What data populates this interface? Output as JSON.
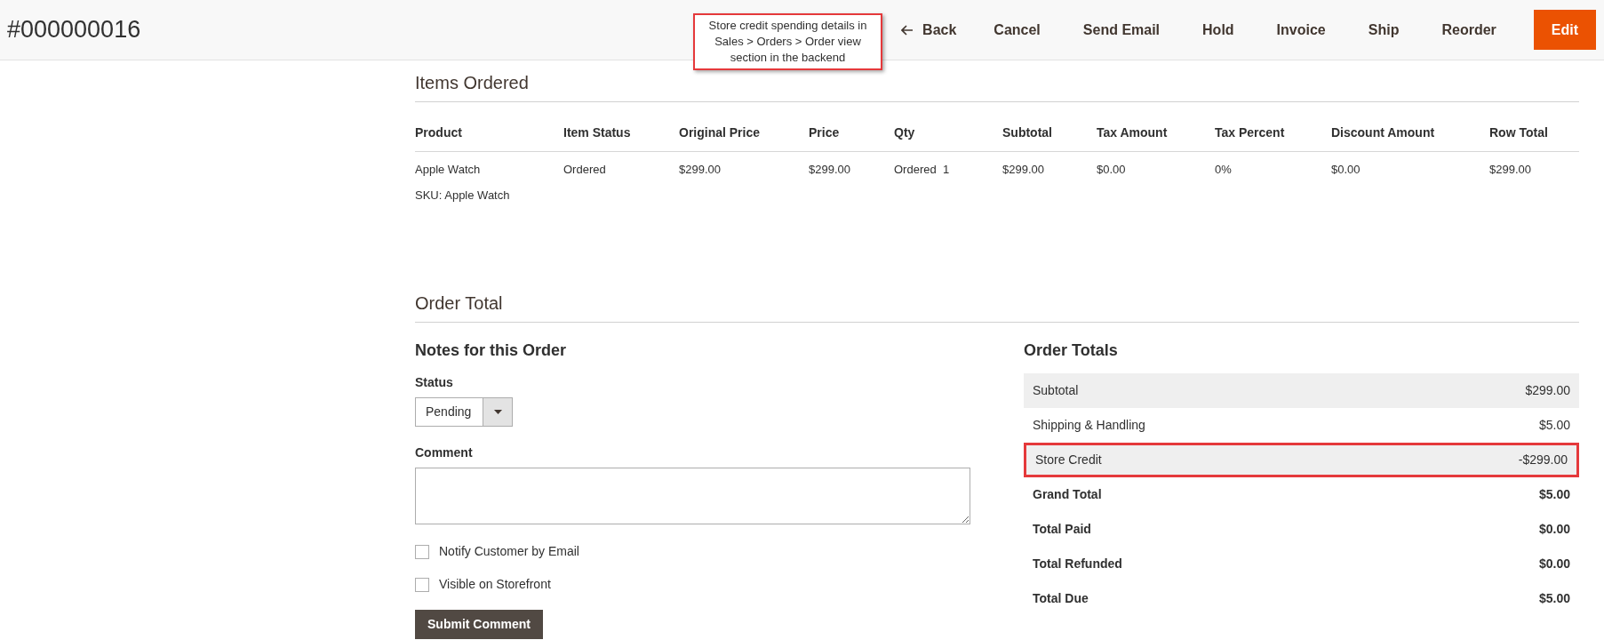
{
  "header": {
    "title": "#000000016",
    "back": "Back",
    "actions": [
      {
        "label": "Cancel",
        "kind": "plain"
      },
      {
        "label": "Send Email",
        "kind": "plain"
      },
      {
        "label": "Hold",
        "kind": "plain"
      },
      {
        "label": "Invoice",
        "kind": "plain"
      },
      {
        "label": "Ship",
        "kind": "plain"
      },
      {
        "label": "Reorder",
        "kind": "plain"
      },
      {
        "label": "Edit",
        "kind": "primary"
      }
    ]
  },
  "annotation": {
    "text": "Store credit spending details in Sales > Orders > Order view section in the backend"
  },
  "items_ordered": {
    "title": "Items Ordered",
    "columns": [
      "Product",
      "Item Status",
      "Original Price",
      "Price",
      "Qty",
      "Subtotal",
      "Tax Amount",
      "Tax Percent",
      "Discount Amount",
      "Row Total"
    ],
    "rows": [
      {
        "sku": "SKU: Apple Watch",
        "cells": [
          "Apple Watch",
          "Ordered",
          "$299.00",
          "$299.00",
          "Ordered  1",
          "$299.00",
          "$0.00",
          "0%",
          "$0.00",
          "$299.00"
        ]
      }
    ]
  },
  "order_total": {
    "title": "Order Total",
    "notes": {
      "title": "Notes for this Order",
      "status_label": "Status",
      "status_value": "Pending",
      "comment_label": "Comment",
      "checkboxes": [
        {
          "label": "Notify Customer by Email",
          "checked": false
        },
        {
          "label": "Visible on Storefront",
          "checked": false
        }
      ],
      "submit": "Submit Comment"
    },
    "totals": {
      "title": "Order Totals",
      "rows": [
        {
          "label": "Subtotal",
          "value": "$299.00",
          "kind": "plain",
          "highlighted": false
        },
        {
          "label": "Shipping & Handling",
          "value": "$5.00",
          "kind": "plain",
          "highlighted": false
        },
        {
          "label": "Store Credit",
          "value": "-$299.00",
          "kind": "plain",
          "highlighted": true
        },
        {
          "label": "Grand Total",
          "value": "$5.00",
          "kind": "total",
          "highlighted": false
        },
        {
          "label": "Total Paid",
          "value": "$0.00",
          "kind": "total",
          "highlighted": false
        },
        {
          "label": "Total Refunded",
          "value": "$0.00",
          "kind": "total",
          "highlighted": false
        },
        {
          "label": "Total Due",
          "value": "$5.00",
          "kind": "total",
          "highlighted": false
        }
      ]
    }
  }
}
